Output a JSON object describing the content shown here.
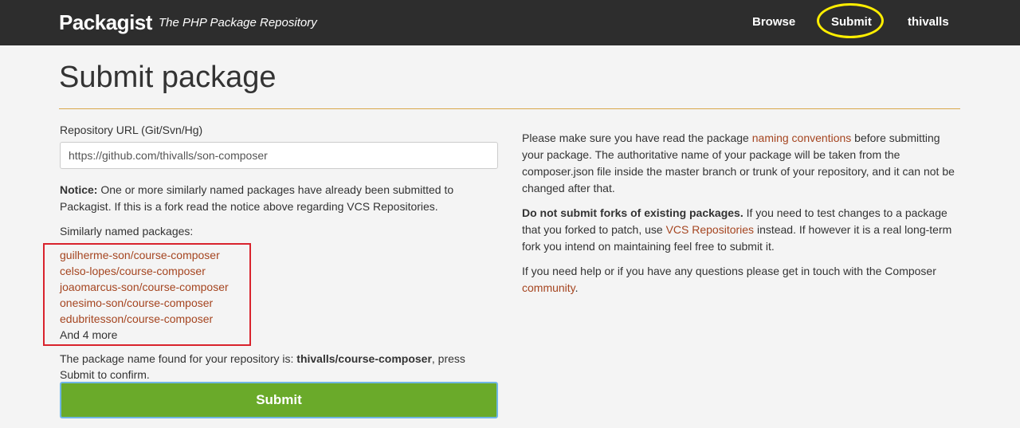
{
  "header": {
    "brand": "Packagist",
    "tagline": "The PHP Package Repository",
    "nav": {
      "browse": "Browse",
      "submit": "Submit",
      "user": "thivalls"
    },
    "highlight_color": "#ffee00"
  },
  "page": {
    "title": "Submit package"
  },
  "form": {
    "url_label": "Repository URL (Git/Svn/Hg)",
    "url_value": "https://github.com/thivalls/son-composer",
    "notice_strong": "Notice:",
    "notice_text": " One or more similarly named packages have already been submitted to Packagist. If this is a fork read the notice above regarding VCS Repositories.",
    "similar_label": "Similarly named packages:",
    "similar_packages": [
      "guilherme-son/course-composer",
      "celso-lopes/course-composer",
      "joaomarcus-son/course-composer",
      "onesimo-son/course-composer",
      "edubritesson/course-composer"
    ],
    "more_text": "And 4 more",
    "found_prefix": "The package name found for your repository is: ",
    "found_package": "thivalls/course-composer",
    "found_suffix": ", press Submit to confirm.",
    "submit_label": "Submit",
    "box_color": "#d9232d"
  },
  "sidebar": {
    "p1_before": "Please make sure you have read the package ",
    "p1_link": "naming conventions",
    "p1_after": " before submitting your package. The authoritative name of your package will be taken from the composer.json file inside the master branch or trunk of your repository, and it can not be changed after that.",
    "p2_strong": "Do not submit forks of existing packages.",
    "p2_before": " If you need to test changes to a package that you forked to patch, use ",
    "p2_link": "VCS Repositories",
    "p2_after": " instead. If however it is a real long-term fork you intend on maintaining feel free to submit it.",
    "p3_before": "If you need help or if you have any questions please get in touch with the Composer ",
    "p3_link": "community",
    "p3_after": "."
  },
  "colors": {
    "navbar_bg": "#2d2d2d",
    "link": "#a54520",
    "submit_bg": "#6aaa2a",
    "rule": "#d9a74a"
  }
}
